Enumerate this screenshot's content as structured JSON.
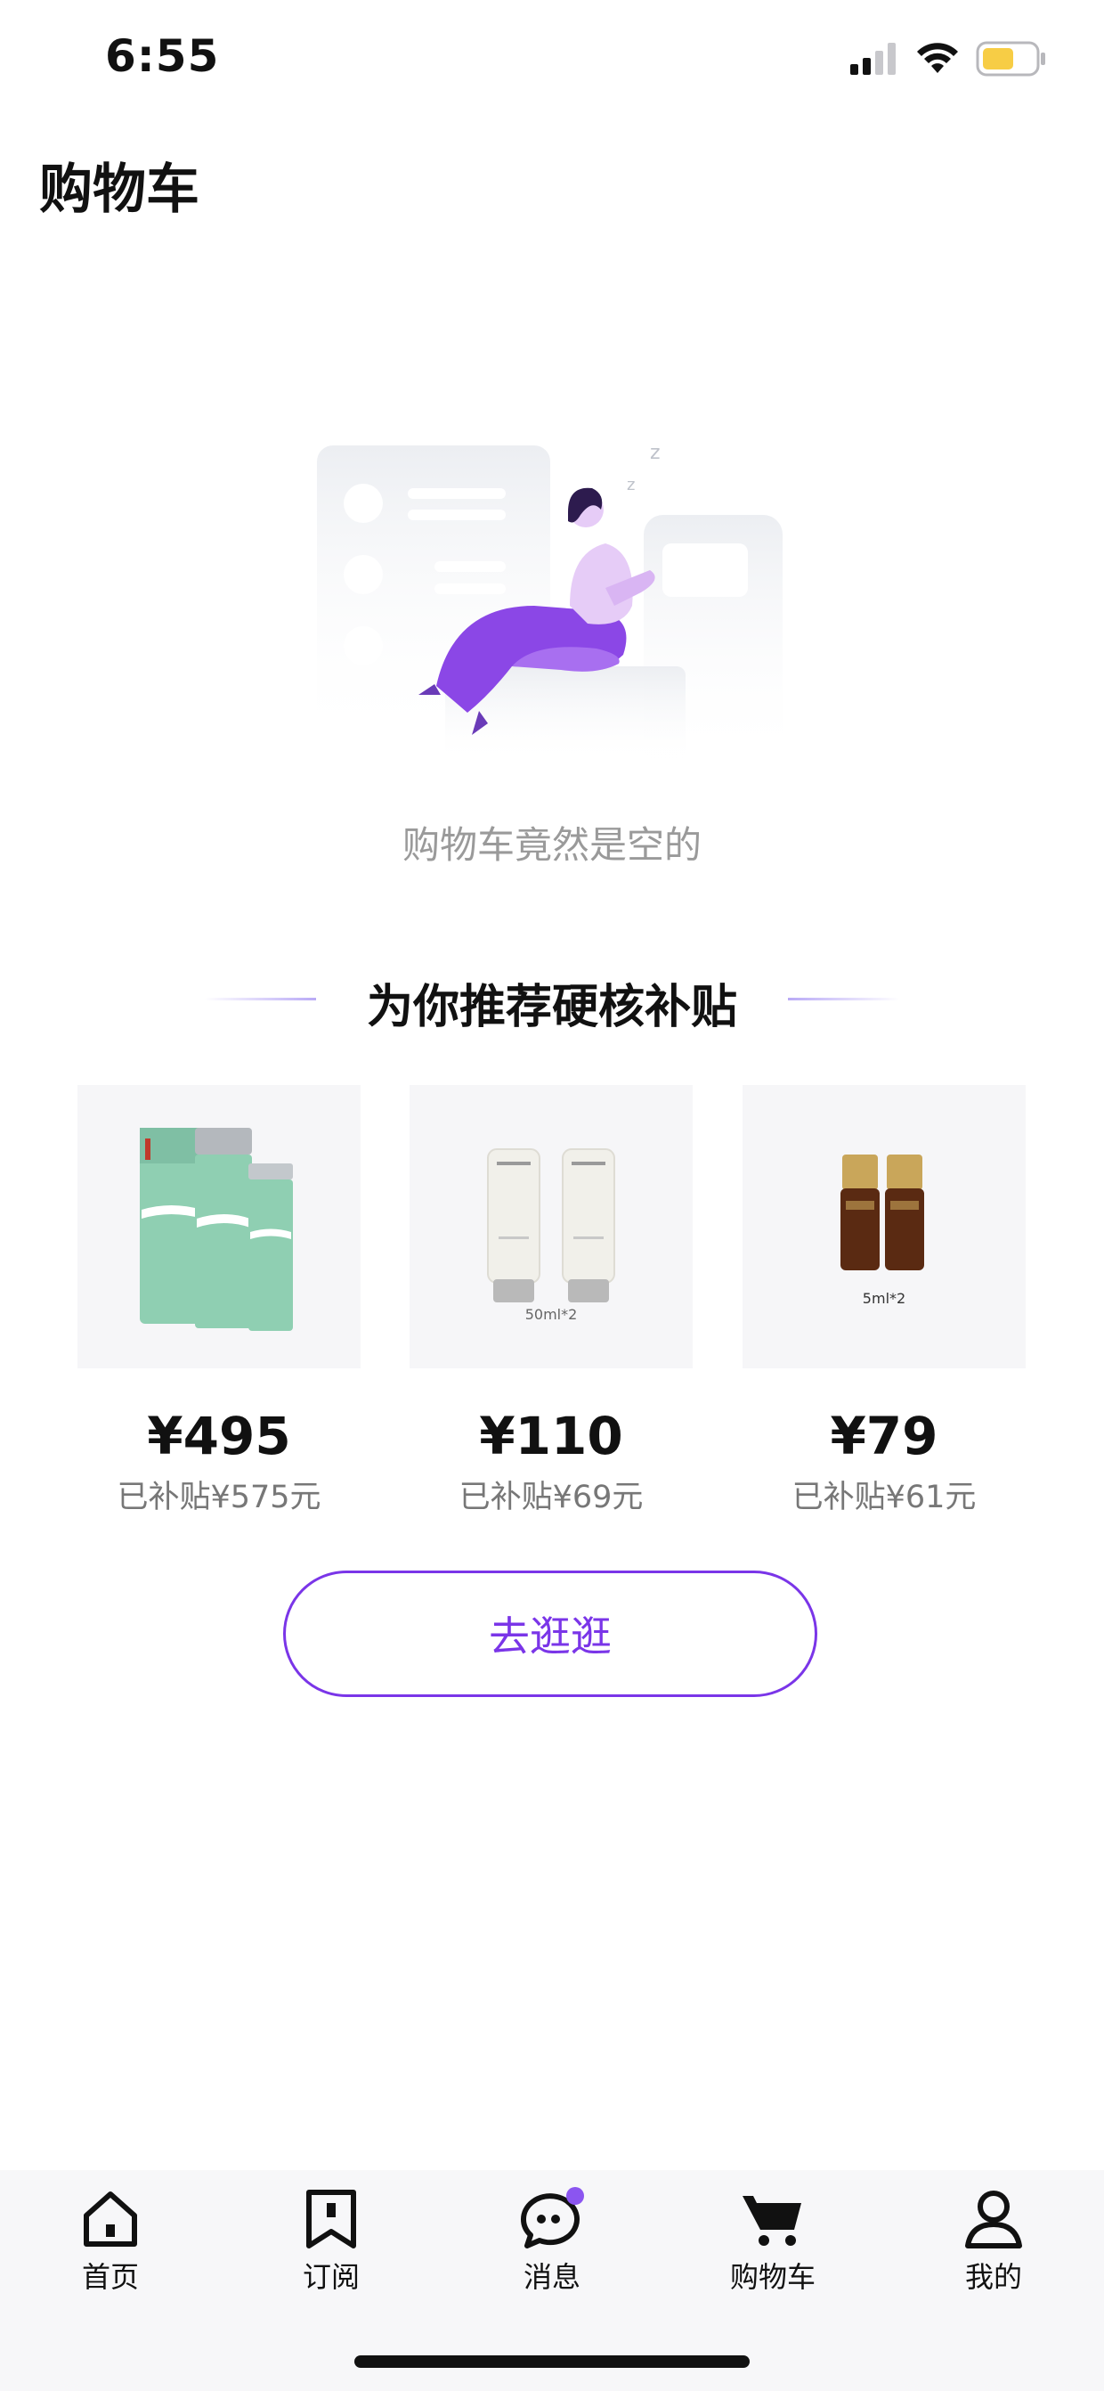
{
  "status_bar": {
    "time": "6:55"
  },
  "header": {
    "title": "购物车"
  },
  "empty_state": {
    "message": "购物车竟然是空的"
  },
  "recommend": {
    "title": "为你推荐硬核补贴",
    "products": [
      {
        "price": "¥495",
        "subsidy": "已补贴¥575元",
        "image_caption": ""
      },
      {
        "price": "¥110",
        "subsidy": "已补贴¥69元",
        "image_caption": "50ml*2"
      },
      {
        "price": "¥79",
        "subsidy": "已补贴¥61元",
        "image_caption": "5ml*2"
      }
    ]
  },
  "actions": {
    "browse_label": "去逛逛"
  },
  "tab_bar": {
    "items": [
      {
        "label": "首页",
        "icon": "home-icon"
      },
      {
        "label": "订阅",
        "icon": "bookmark-icon"
      },
      {
        "label": "消息",
        "icon": "message-icon"
      },
      {
        "label": "购物车",
        "icon": "cart-icon"
      },
      {
        "label": "我的",
        "icon": "profile-icon"
      }
    ]
  },
  "colors": {
    "accent": "#7a35e8",
    "battery": "#f7cd45"
  }
}
